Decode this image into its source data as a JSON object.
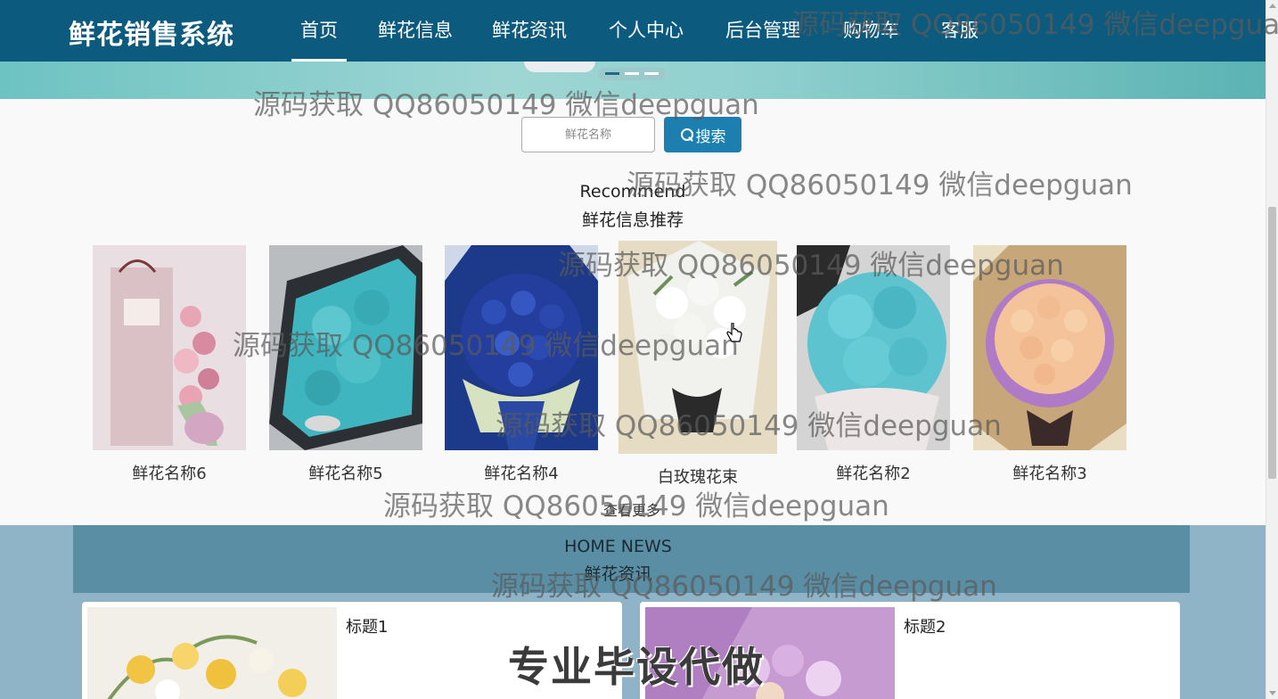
{
  "nav": {
    "brand": "鲜花销售系统",
    "items": [
      {
        "label": "首页",
        "active": true
      },
      {
        "label": "鲜花信息",
        "active": false
      },
      {
        "label": "鲜花资讯",
        "active": false
      },
      {
        "label": "个人中心",
        "active": false
      },
      {
        "label": "后台管理",
        "active": false
      },
      {
        "label": "购物车",
        "active": false
      },
      {
        "label": "客服",
        "active": false
      }
    ],
    "bg_color": "#0c5a7e"
  },
  "banner": {
    "dots_total": 3,
    "dot_active": 1
  },
  "search": {
    "placeholder": "鲜花名称",
    "button_label": "搜索",
    "button_color": "#1d7fb0"
  },
  "recommend": {
    "title_en": "Recommend",
    "title_cn": "鲜花信息推荐",
    "items": [
      {
        "name": "鲜花名称6"
      },
      {
        "name": "鲜花名称5"
      },
      {
        "name": "鲜花名称4"
      },
      {
        "name": "白玫瑰花束"
      },
      {
        "name": "鲜花名称2"
      },
      {
        "name": "鲜花名称3"
      }
    ],
    "more_label": "查看更多"
  },
  "news": {
    "title_en": "HOME NEWS",
    "title_cn": "鲜花资讯",
    "items": [
      {
        "title": "标题1"
      },
      {
        "title": "标题2"
      }
    ]
  },
  "watermark": {
    "text": "源码获取 QQ86050149 微信deepguan",
    "banner_text": "专业毕设代做"
  }
}
